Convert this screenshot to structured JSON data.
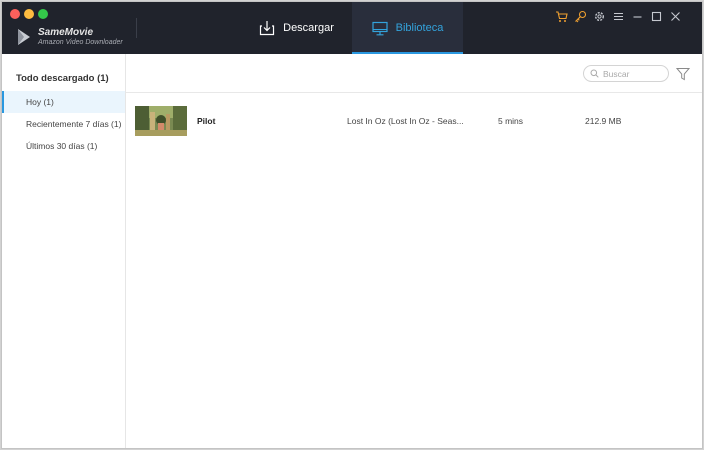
{
  "app": {
    "name": "SameMovie",
    "subtitle": "Amazon Video Downloader"
  },
  "nav": {
    "download_label": "Descargar",
    "library_label": "Biblioteca",
    "active": "library"
  },
  "toolbar_icons": [
    "cart-icon",
    "key-icon",
    "gear-icon",
    "menu-icon",
    "minimize-icon",
    "maximize-icon",
    "close-icon"
  ],
  "sidebar": {
    "title": "Todo descargado (1)",
    "items": [
      {
        "label": "Hoy (1)",
        "active": true
      },
      {
        "label": "Recientemente 7 días (1)",
        "active": false
      },
      {
        "label": "Últimos 30 días (1)",
        "active": false
      }
    ]
  },
  "search": {
    "placeholder": "Buscar",
    "value": ""
  },
  "list": {
    "rows": [
      {
        "title": "Pilot",
        "series": "Lost In Oz (Lost In Oz - Seas...",
        "duration": "5 mins",
        "size": "212.9 MB"
      }
    ]
  },
  "colors": {
    "titlebar": "#20232c",
    "active_tab_bg": "#292e3c",
    "accent": "#2a98e0",
    "tool_icon_orange": "#f0a030"
  }
}
